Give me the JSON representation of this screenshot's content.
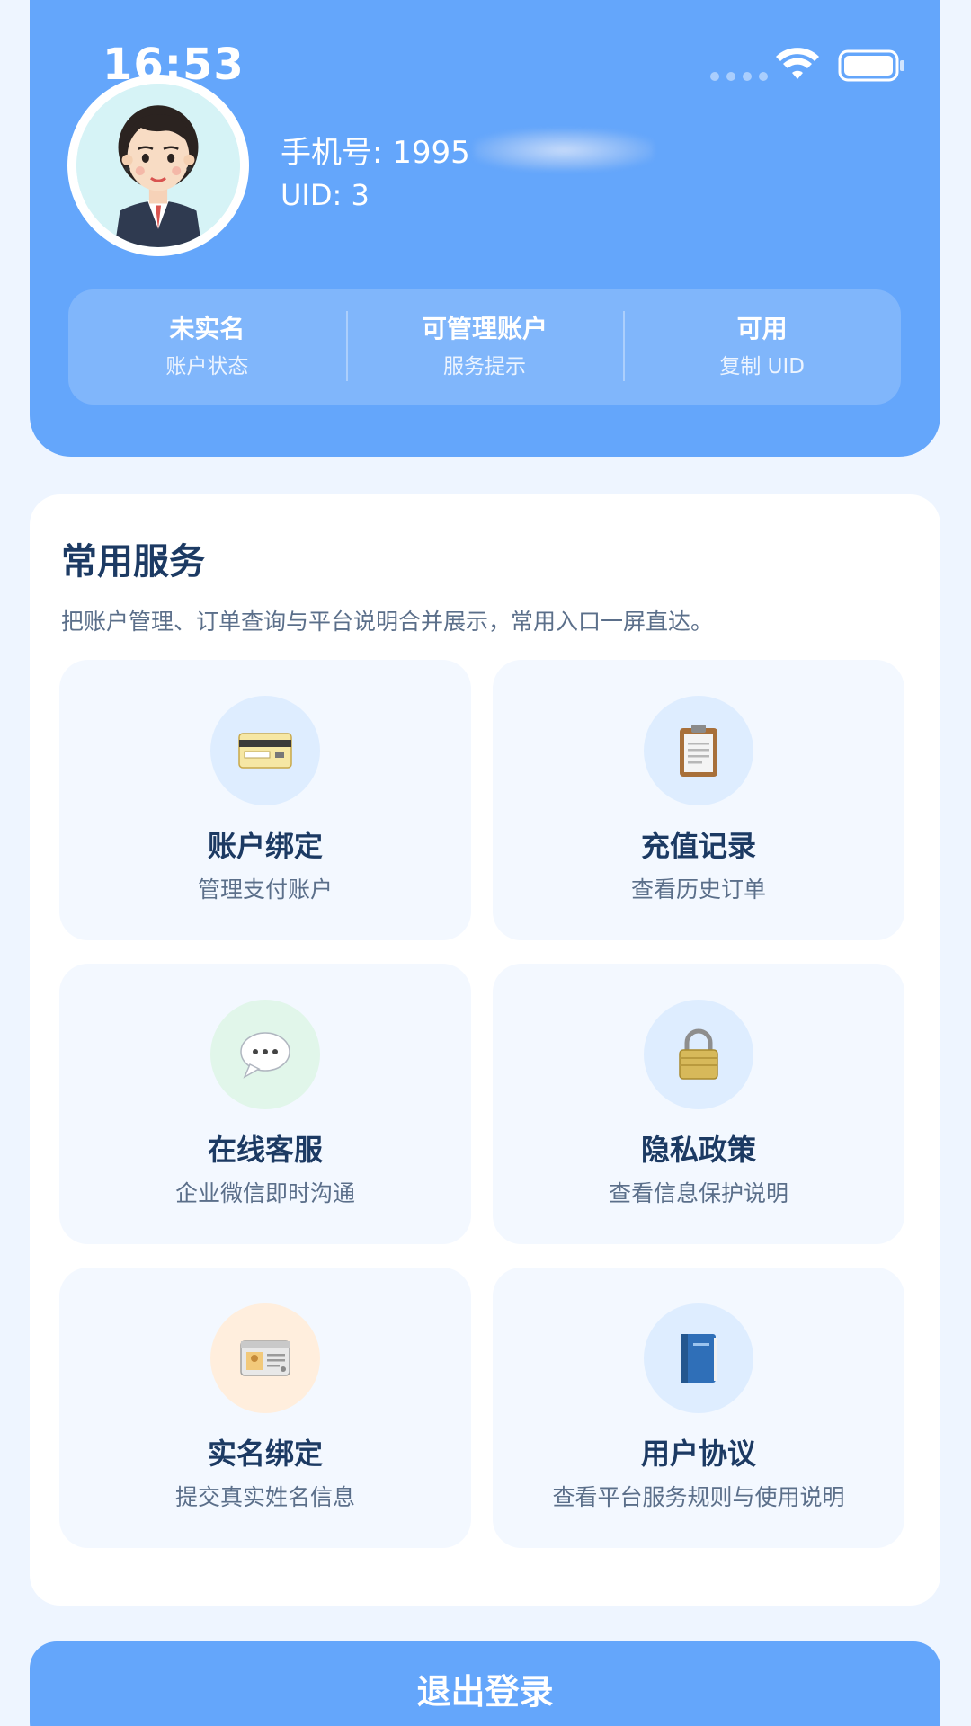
{
  "status_bar": {
    "time": "16:53"
  },
  "profile": {
    "phone_label": "手机号: 1995",
    "uid_label": "UID: 3"
  },
  "stats": [
    {
      "value": "未实名",
      "label": "账户状态"
    },
    {
      "value": "可管理账户",
      "label": "服务提示"
    },
    {
      "value": "可用",
      "label": "复制 UID"
    }
  ],
  "services": {
    "title": "常用服务",
    "description": "把账户管理、订单查询与平台说明合并展示，常用入口一屏直达。",
    "items": [
      {
        "title": "账户绑定",
        "subtitle": "管理支付账户",
        "icon": "credit-card-icon"
      },
      {
        "title": "充值记录",
        "subtitle": "查看历史订单",
        "icon": "clipboard-icon"
      },
      {
        "title": "在线客服",
        "subtitle": "企业微信即时沟通",
        "icon": "speech-bubble-icon"
      },
      {
        "title": "隐私政策",
        "subtitle": "查看信息保护说明",
        "icon": "lock-icon"
      },
      {
        "title": "实名绑定",
        "subtitle": "提交真实姓名信息",
        "icon": "id-card-icon"
      },
      {
        "title": "用户协议",
        "subtitle": "查看平台服务规则与使用说明",
        "icon": "book-icon"
      }
    ]
  },
  "logout": {
    "label": "退出登录"
  },
  "colors": {
    "primary": "#64a6fb",
    "background": "#eef5ff",
    "title_text": "#1c3a63",
    "muted_text": "#5b6f8a"
  }
}
